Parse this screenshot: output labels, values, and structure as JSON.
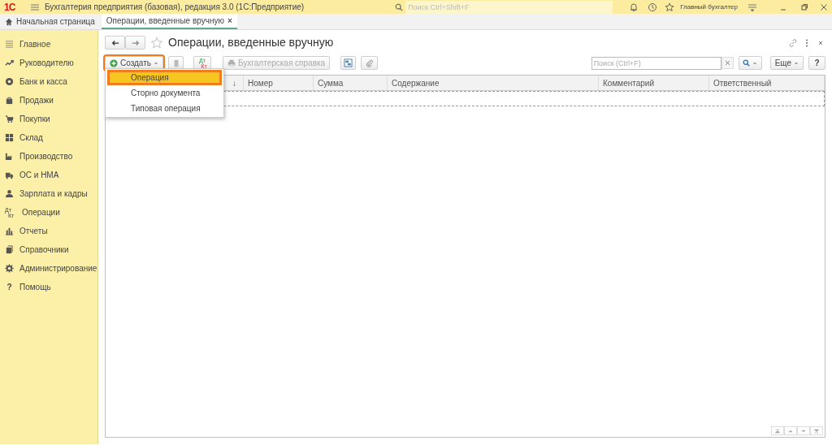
{
  "app": {
    "logo": "1С",
    "title": "Бухгалтерия предприятия (базовая), редакция 3.0  (1С:Предприятие)",
    "search": {
      "placeholder": "Поиск Ctrl+Shift+F"
    },
    "user": "Главный бухгалтер"
  },
  "tabs": [
    {
      "label": "Начальная страница",
      "selected": false,
      "kind": "home"
    },
    {
      "label": "Операции, введенные вручную",
      "selected": true,
      "kind": "form",
      "close": "×"
    }
  ],
  "sidebar": {
    "items": [
      {
        "label": "Главное"
      },
      {
        "label": "Руководителю"
      },
      {
        "label": "Банк и касса"
      },
      {
        "label": "Продажи"
      },
      {
        "label": "Покупки"
      },
      {
        "label": "Склад"
      },
      {
        "label": "Производство"
      },
      {
        "label": "ОС и НМА"
      },
      {
        "label": "Зарплата и кадры"
      },
      {
        "label": "Операции",
        "glyph": [
          "Дт",
          "Кт"
        ]
      },
      {
        "label": "Отчеты"
      },
      {
        "label": "Справочники"
      },
      {
        "label": "Администрирование"
      },
      {
        "label": "Помощь",
        "mark": "?"
      }
    ]
  },
  "form": {
    "title": "Операции, введенные вручную",
    "favorite": false,
    "toolbar": {
      "create": {
        "label": "Создать",
        "highlighted": true
      },
      "dtkt": [
        "Дт",
        "Кт"
      ],
      "report": {
        "label": "Бухгалтерская справка",
        "disabled": true
      },
      "search": {
        "placeholder": "Поиск (Ctrl+F)"
      },
      "more": "Еще",
      "help": "?"
    },
    "menu": {
      "items": [
        {
          "label": "Операция",
          "selected": true,
          "highlighted": true
        },
        {
          "label": "Сторно документа",
          "selected": false,
          "highlighted": false
        },
        {
          "label": "Типовая операция",
          "selected": false,
          "highlighted": false
        }
      ]
    },
    "table": {
      "columns": [
        {
          "sort_mark": "↓"
        },
        {
          "label": "Номер"
        },
        {
          "label": "Сумма"
        },
        {
          "label": "Содержание"
        },
        {
          "label": "Комментарий"
        },
        {
          "label": "Ответственный"
        }
      ]
    }
  }
}
